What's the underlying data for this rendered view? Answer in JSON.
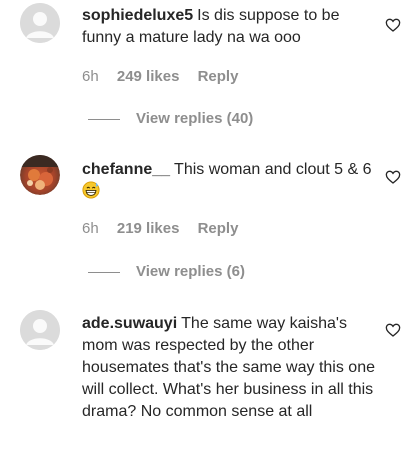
{
  "comments": [
    {
      "username": "sophiedeluxe5",
      "text": "Is dis suppose to be funny a mature lady na wa ooo",
      "time": "6h",
      "likes": "249 likes",
      "reply_label": "Reply",
      "view_replies": "View replies (40)",
      "avatar_icon": "default-avatar-icon"
    },
    {
      "username": "chefanne__",
      "text": "This woman and clout 5 & 6",
      "emoji": "grinning-sweat-emoji",
      "time": "6h",
      "likes": "219 likes",
      "reply_label": "Reply",
      "view_replies": "View replies (6)",
      "avatar_icon": "profile-photo"
    },
    {
      "username": "ade.suwauyi",
      "text": "The same way kaisha's mom was respected by the other housemates that's the same way this one will collect. What's her business in all this drama? No common sense at all",
      "avatar_icon": "default-avatar-icon"
    }
  ],
  "colors": {
    "text": "#262626",
    "secondary": "#8e8e8e",
    "avatar_placeholder": "#dbdbdb"
  }
}
